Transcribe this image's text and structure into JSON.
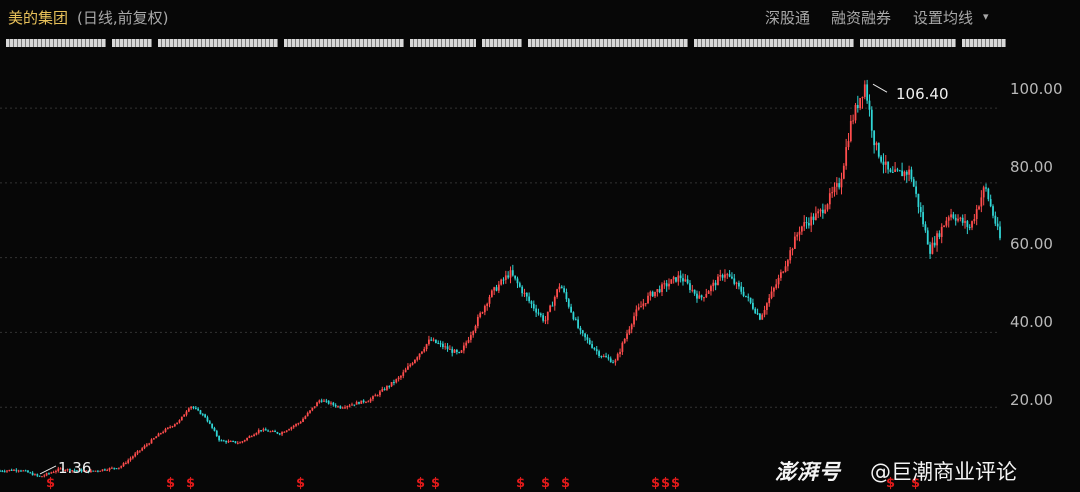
{
  "header": {
    "title": "美的集团",
    "subtitle": "(日线,前复权)",
    "menu": [
      "深股通",
      "融资融券",
      "设置均线"
    ],
    "menu_arrow": "▾"
  },
  "watermark": {
    "brand": "澎湃号",
    "author": "@巨潮商业评论"
  },
  "dividend_marker": "$",
  "colors": {
    "background": "#070707",
    "title": "#e8c15a",
    "up_candle": "#ff4d4d",
    "down_candle": "#30d5d5",
    "grid": "#333333",
    "dividend": "#e01a1a"
  },
  "chart_data": {
    "type": "candlestick",
    "title": "",
    "ylim": [
      0,
      115
    ],
    "y_ticks": [
      "100.00",
      "80.00",
      "60.00",
      "40.00",
      "20.00"
    ],
    "y_tick_values": [
      100,
      80,
      60,
      40,
      20
    ],
    "grid": true,
    "annotations": [
      {
        "label": "106.40",
        "kind": "high",
        "value": 106.4
      },
      {
        "label": "1.36",
        "kind": "low",
        "value": 1.36
      }
    ],
    "price_path": [
      [
        0.0,
        3.0
      ],
      [
        0.02,
        3.3
      ],
      [
        0.04,
        1.36
      ],
      [
        0.06,
        3.5
      ],
      [
        0.09,
        2.8
      ],
      [
        0.12,
        4.0
      ],
      [
        0.14,
        8.5
      ],
      [
        0.16,
        13.0
      ],
      [
        0.18,
        16.5
      ],
      [
        0.19,
        20.5
      ],
      [
        0.205,
        17.5
      ],
      [
        0.22,
        11.0
      ],
      [
        0.24,
        10.5
      ],
      [
        0.26,
        14.0
      ],
      [
        0.28,
        13.0
      ],
      [
        0.3,
        16.0
      ],
      [
        0.32,
        22.0
      ],
      [
        0.34,
        20.0
      ],
      [
        0.37,
        22.0
      ],
      [
        0.4,
        28.0
      ],
      [
        0.43,
        38.0
      ],
      [
        0.46,
        34.0
      ],
      [
        0.49,
        50.0
      ],
      [
        0.51,
        56.0
      ],
      [
        0.53,
        48.0
      ],
      [
        0.545,
        43.0
      ],
      [
        0.56,
        53.0
      ],
      [
        0.58,
        40.0
      ],
      [
        0.6,
        34.0
      ],
      [
        0.615,
        32.0
      ],
      [
        0.635,
        45.0
      ],
      [
        0.65,
        50.0
      ],
      [
        0.68,
        55.0
      ],
      [
        0.7,
        49.0
      ],
      [
        0.725,
        56.0
      ],
      [
        0.745,
        50.0
      ],
      [
        0.76,
        44.0
      ],
      [
        0.78,
        55.0
      ],
      [
        0.8,
        68.0
      ],
      [
        0.82,
        72.0
      ],
      [
        0.84,
        80.0
      ],
      [
        0.85,
        95.0
      ],
      [
        0.86,
        103.0
      ],
      [
        0.865,
        106.4
      ],
      [
        0.875,
        90.0
      ],
      [
        0.89,
        82.0
      ],
      [
        0.91,
        83.0
      ],
      [
        0.93,
        62.0
      ],
      [
        0.95,
        72.0
      ],
      [
        0.97,
        68.0
      ],
      [
        0.985,
        79.0
      ],
      [
        1.0,
        65.0
      ]
    ],
    "dividend_positions": [
      0.05,
      0.17,
      0.19,
      0.3,
      0.42,
      0.435,
      0.52,
      0.545,
      0.565,
      0.655,
      0.665,
      0.675,
      0.89,
      0.915
    ]
  }
}
